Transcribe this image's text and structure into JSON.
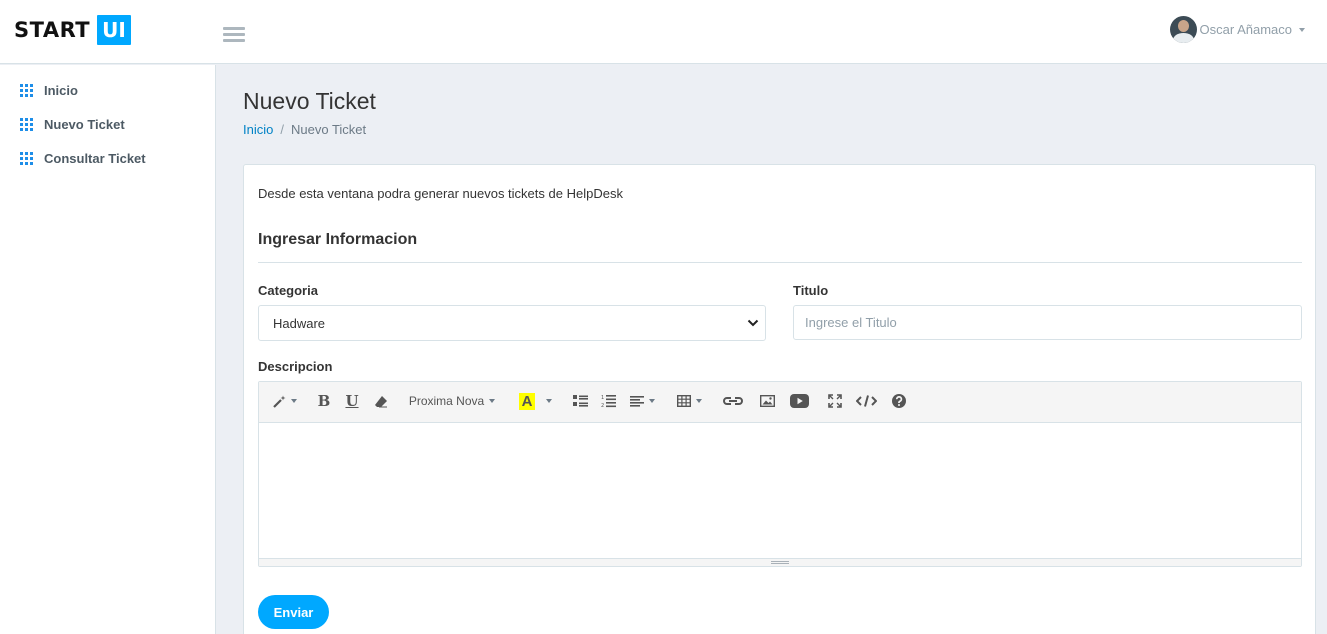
{
  "header": {
    "logo_text": "START",
    "logo_badge": "UI",
    "user_name": "Oscar Añamaco"
  },
  "sidebar": {
    "items": [
      {
        "label": "Inicio",
        "icon": "grid-icon"
      },
      {
        "label": "Nuevo Ticket",
        "icon": "grid-icon"
      },
      {
        "label": "Consultar Ticket",
        "icon": "grid-icon"
      }
    ]
  },
  "page": {
    "title": "Nuevo Ticket",
    "breadcrumb": {
      "home": "Inicio",
      "separator": "/",
      "current": "Nuevo Ticket"
    }
  },
  "form": {
    "intro": "Desde esta ventana podra generar nuevos tickets de HelpDesk",
    "section_title": "Ingresar Informacion",
    "category_label": "Categoria",
    "category_value": "Hadware",
    "title_label": "Titulo",
    "title_placeholder": "Ingrese el Titulo",
    "title_value": "",
    "description_label": "Descripcion",
    "submit_label": "Enviar"
  },
  "editor": {
    "font_name": "Proxima Nova",
    "highlight_letter": "A",
    "bold_letter": "B",
    "underline_letter": "U",
    "highlight_color": "#ffff00"
  },
  "colors": {
    "accent": "#00a8ff",
    "link": "#0082c6",
    "icon_blue": "#1e8ee8"
  }
}
